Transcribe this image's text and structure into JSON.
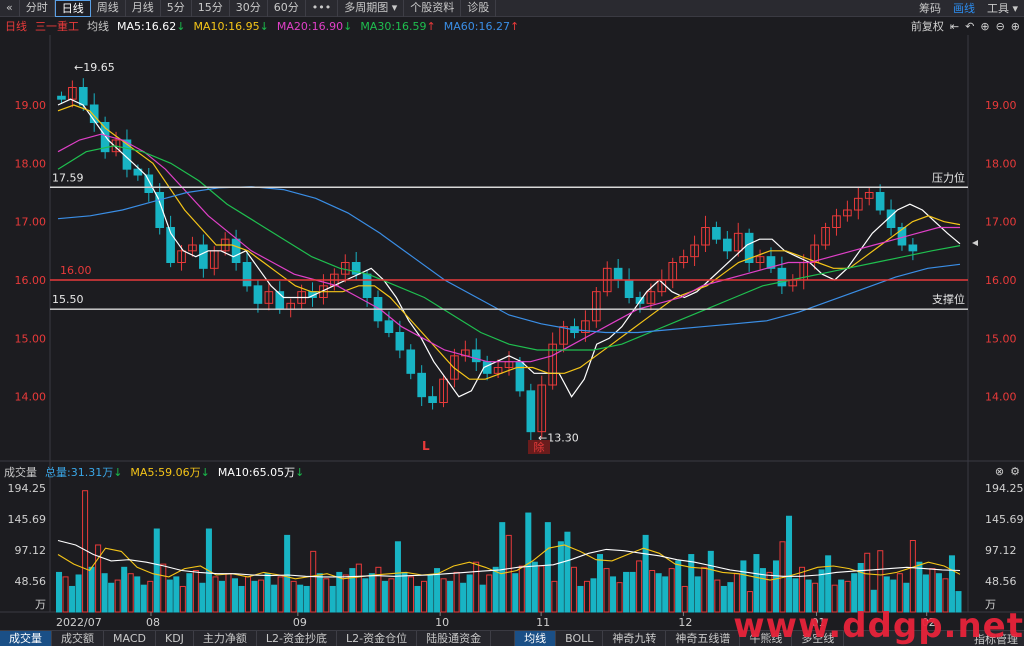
{
  "toolbar": {
    "back_glyph": "«",
    "tabs": [
      "分时",
      "日线",
      "周线",
      "月线",
      "5分",
      "15分",
      "30分",
      "60分",
      "•••",
      "多周期图 ▾",
      "个股资料",
      "诊股"
    ],
    "active_tab": 1,
    "right_items": [
      "筹码",
      "画线",
      "工具 ▾"
    ],
    "right_active": 1
  },
  "ma_bar": {
    "period": "日线",
    "stock_name": "三一重工",
    "avg_label": "均线",
    "ma": [
      {
        "label": "MA5:16.62",
        "arrow": "↓",
        "color": "#ffffff",
        "arrow_color": "#19b94b"
      },
      {
        "label": "MA10:16.95",
        "arrow": "↓",
        "color": "#f5c518",
        "arrow_color": "#19b94b"
      },
      {
        "label": "MA20:16.90",
        "arrow": "↓",
        "color": "#e040c8",
        "arrow_color": "#19b94b"
      },
      {
        "label": "MA30:16.59",
        "arrow": "↑",
        "color": "#1fbf4f",
        "arrow_color": "#e83a3a"
      },
      {
        "label": "MA60:16.27",
        "arrow": "↑",
        "color": "#3a8ee6",
        "arrow_color": "#e83a3a"
      }
    ],
    "right_tools": [
      "前复权",
      "⇤",
      "↶",
      "⊕",
      "⊖",
      "⊕"
    ]
  },
  "volume_bar": {
    "title": "成交量",
    "total": "总量:31.31万",
    "total_arrow": "↓",
    "ma5": "MA5:59.06万",
    "ma5_arrow": "↓",
    "ma10": "MA10:65.05万",
    "ma10_arrow": "↓",
    "right_tools": [
      "⊗",
      "⚙"
    ]
  },
  "bottom_tabs": {
    "left": [
      "成交量",
      "成交额",
      "MACD",
      "KDJ",
      "主力净额",
      "L2-资金抄底",
      "L2-资金仓位",
      "陆股通资金"
    ],
    "left_active": 0,
    "right": [
      "均线",
      "BOLL",
      "神奇九转",
      "神奇五线谱",
      "牛熊线",
      "多空线"
    ],
    "right_active": 0,
    "far_right": "指标管理"
  },
  "watermark": "www.ddgp.net",
  "colors": {
    "up": "#e83a3a",
    "down": "#18b4c4",
    "ma5": "#ffffff",
    "ma10": "#f5c518",
    "ma20": "#e040c8",
    "ma30": "#1fbf4f",
    "ma60": "#3a8ee6",
    "price_axis": "#e83a3a",
    "level_line": "#d8d8d8",
    "red_level": "#e83a3a"
  },
  "chart_data": [
    {
      "type": "candlestick",
      "x_labels": [
        "2022/07",
        "08",
        "09",
        "10",
        "11",
        "12",
        "01",
        "02"
      ],
      "y_ticks": [
        19.0,
        18.0,
        17.0,
        16.0,
        15.0,
        14.0
      ],
      "y_tick_labels": [
        "19.00",
        "18.00",
        "17.00",
        "16.00",
        "15.00",
        "14.00"
      ],
      "ylim": [
        13.0,
        20.2
      ],
      "grid": false,
      "annotations": [
        {
          "text": "←19.65",
          "price": 19.65
        },
        {
          "text": "←13.30",
          "price": 13.3
        },
        {
          "text": "L",
          "color": "#e83a3a"
        },
        {
          "text": "除",
          "color": "#e83a3a"
        }
      ],
      "levels": [
        {
          "price": 17.59,
          "label_left": "17.59",
          "label_right": "压力位",
          "color": "#d8d8d8"
        },
        {
          "price": 16.0,
          "label_left": "16.00",
          "label_right": "",
          "color": "#e83a3a"
        },
        {
          "price": 15.5,
          "label_left": "15.50",
          "label_right": "支撑位",
          "color": "#d8d8d8"
        }
      ],
      "close_path": [
        19.1,
        19.3,
        19.0,
        18.7,
        18.2,
        18.4,
        17.9,
        17.8,
        17.5,
        16.9,
        16.3,
        16.5,
        16.6,
        16.2,
        16.5,
        16.7,
        16.3,
        15.9,
        15.6,
        15.8,
        15.5,
        15.6,
        15.8,
        15.7,
        15.9,
        16.1,
        16.3,
        16.1,
        15.7,
        15.3,
        15.1,
        14.8,
        14.4,
        14.0,
        13.9,
        14.3,
        14.7,
        14.8,
        14.6,
        14.4,
        14.5,
        14.6,
        14.1,
        13.4,
        14.2,
        14.9,
        15.2,
        15.1,
        15.3,
        15.8,
        16.2,
        16.0,
        15.7,
        15.6,
        15.8,
        16.0,
        16.3,
        16.4,
        16.6,
        16.9,
        16.7,
        16.5,
        16.8,
        16.3,
        16.4,
        16.2,
        15.9,
        16.0,
        16.3,
        16.6,
        16.9,
        17.1,
        17.2,
        17.4,
        17.5,
        17.2,
        16.9,
        16.6,
        16.5
      ],
      "ma_series": [
        {
          "name": "MA5",
          "values": [
            19.0,
            19.1,
            19.0,
            18.7,
            18.4,
            18.2,
            18.0,
            17.8,
            17.4,
            16.8,
            16.5,
            16.4,
            16.5,
            16.5,
            16.4,
            16.5,
            16.2,
            15.9,
            15.7,
            15.7,
            15.7,
            15.8,
            15.9,
            16.0,
            16.1,
            16.2,
            16.0,
            15.7,
            15.3,
            15.0,
            14.6,
            14.3,
            14.0,
            14.1,
            14.5,
            14.6,
            14.7,
            14.6,
            14.4,
            14.4,
            14.4,
            14.0,
            14.3,
            14.9,
            15.0,
            15.2,
            15.5,
            15.8,
            16.0,
            15.8,
            15.7,
            15.8,
            16.0,
            16.2,
            16.4,
            16.6,
            16.7,
            16.7,
            16.5,
            16.4,
            16.3,
            16.1,
            16.0,
            16.2,
            16.5,
            16.8,
            17.0,
            17.2,
            17.3,
            17.2,
            17.0,
            16.8,
            16.62
          ]
        },
        {
          "name": "MA10",
          "values": [
            18.9,
            19.0,
            18.9,
            18.6,
            18.4,
            18.2,
            18.0,
            17.6,
            17.2,
            16.9,
            16.6,
            16.6,
            16.5,
            16.3,
            16.1,
            15.9,
            15.8,
            15.8,
            15.8,
            15.9,
            15.9,
            15.7,
            15.4,
            15.1,
            14.8,
            14.5,
            14.3,
            14.3,
            14.4,
            14.5,
            14.5,
            14.4,
            14.4,
            14.5,
            14.7,
            14.9,
            15.1,
            15.3,
            15.5,
            15.7,
            15.8,
            15.9,
            16.1,
            16.3,
            16.4,
            16.5,
            16.5,
            16.4,
            16.3,
            16.2,
            16.2,
            16.4,
            16.6,
            16.8,
            17.0,
            17.1,
            17.0,
            16.95
          ]
        },
        {
          "name": "MA20",
          "values": [
            18.2,
            18.4,
            18.5,
            18.4,
            18.2,
            17.9,
            17.5,
            17.1,
            16.8,
            16.5,
            16.3,
            16.1,
            16.0,
            15.9,
            15.7,
            15.5,
            15.2,
            15.0,
            14.8,
            14.7,
            14.6,
            14.6,
            14.6,
            14.7,
            14.9,
            15.1,
            15.3,
            15.5,
            15.6,
            15.7,
            15.9,
            16.0,
            16.1,
            16.2,
            16.3,
            16.3,
            16.4,
            16.5,
            16.6,
            16.7,
            16.8,
            16.9,
            16.9
          ]
        },
        {
          "name": "MA30",
          "values": [
            17.9,
            18.2,
            18.3,
            18.2,
            18.0,
            17.7,
            17.3,
            17.0,
            16.7,
            16.4,
            16.2,
            16.1,
            15.9,
            15.7,
            15.4,
            15.1,
            14.9,
            14.8,
            14.8,
            14.8,
            14.9,
            15.1,
            15.3,
            15.5,
            15.7,
            15.9,
            16.0,
            16.1,
            16.2,
            16.3,
            16.4,
            16.5,
            16.59
          ]
        },
        {
          "name": "MA60",
          "values": [
            17.05,
            17.1,
            17.2,
            17.35,
            17.5,
            17.58,
            17.6,
            17.55,
            17.4,
            17.15,
            16.8,
            16.4,
            16.0,
            15.7,
            15.4,
            15.25,
            15.15,
            15.1,
            15.1,
            15.15,
            15.2,
            15.25,
            15.3,
            15.45,
            15.65,
            15.85,
            16.05,
            16.2,
            16.27
          ]
        }
      ]
    },
    {
      "type": "bar",
      "name": "成交量",
      "y_ticks": [
        194.25,
        145.69,
        97.12,
        48.56
      ],
      "y_tick_labels": [
        "194.25",
        "145.69",
        "97.12",
        "48.56"
      ],
      "unit_label": "万",
      "ylim": [
        0,
        194.25
      ],
      "volume_profile": [
        62,
        55,
        40,
        58,
        190,
        70,
        105,
        60,
        45,
        50,
        70,
        60,
        55,
        42,
        48,
        130,
        75,
        50,
        55,
        40,
        60,
        65,
        45,
        130,
        55,
        48,
        60,
        52,
        40,
        55,
        48,
        50,
        60,
        42,
        55,
        120,
        48,
        42,
        40,
        95,
        60,
        52,
        40,
        62,
        58,
        68,
        75,
        52,
        60,
        70,
        48,
        52,
        110,
        62,
        55,
        40,
        48,
        58,
        68,
        52,
        48,
        62,
        45,
        58,
        78,
        42,
        58,
        70,
        140,
        120,
        60,
        72,
        155,
        78,
        72,
        140,
        48,
        110,
        125,
        70,
        40,
        48,
        52,
        90,
        68,
        55,
        46,
        62,
        62,
        80,
        120,
        65,
        60,
        55,
        68,
        80,
        40,
        90,
        55,
        70,
        95,
        50,
        40,
        46,
        60,
        80,
        32,
        90,
        68,
        62,
        80,
        110,
        150,
        52,
        70,
        50,
        45,
        66,
        88,
        42,
        50,
        48,
        60,
        76,
        92,
        34,
        96,
        55,
        50,
        60,
        45,
        112,
        78,
        58,
        68,
        60,
        52,
        88,
        32
      ],
      "ma_series": [
        {
          "name": "MA5",
          "values": [
            90,
            75,
            65,
            100,
            95,
            70,
            60,
            55,
            68,
            72,
            58,
            60,
            55,
            62,
            58,
            52,
            56,
            60,
            52,
            55,
            58,
            60,
            62,
            58,
            60,
            72,
            78,
            70,
            60,
            65,
            80,
            100,
            105,
            95,
            82,
            80,
            90,
            100,
            92,
            75,
            70,
            68,
            62,
            60,
            55,
            50,
            55,
            62,
            70,
            72,
            68,
            60,
            58,
            62,
            70,
            78,
            72,
            59
          ]
        },
        {
          "name": "MA10",
          "values": [
            112,
            105,
            90,
            80,
            82,
            78,
            72,
            65,
            62,
            60,
            60,
            58,
            57,
            58,
            56,
            55,
            55,
            56,
            57,
            56,
            57,
            58,
            60,
            62,
            64,
            66,
            70,
            72,
            74,
            82,
            92,
            98,
            96,
            92,
            88,
            82,
            78,
            72,
            66,
            62,
            58,
            56,
            56,
            58,
            62,
            64,
            66,
            68,
            70,
            68,
            66,
            65
          ]
        }
      ]
    }
  ]
}
